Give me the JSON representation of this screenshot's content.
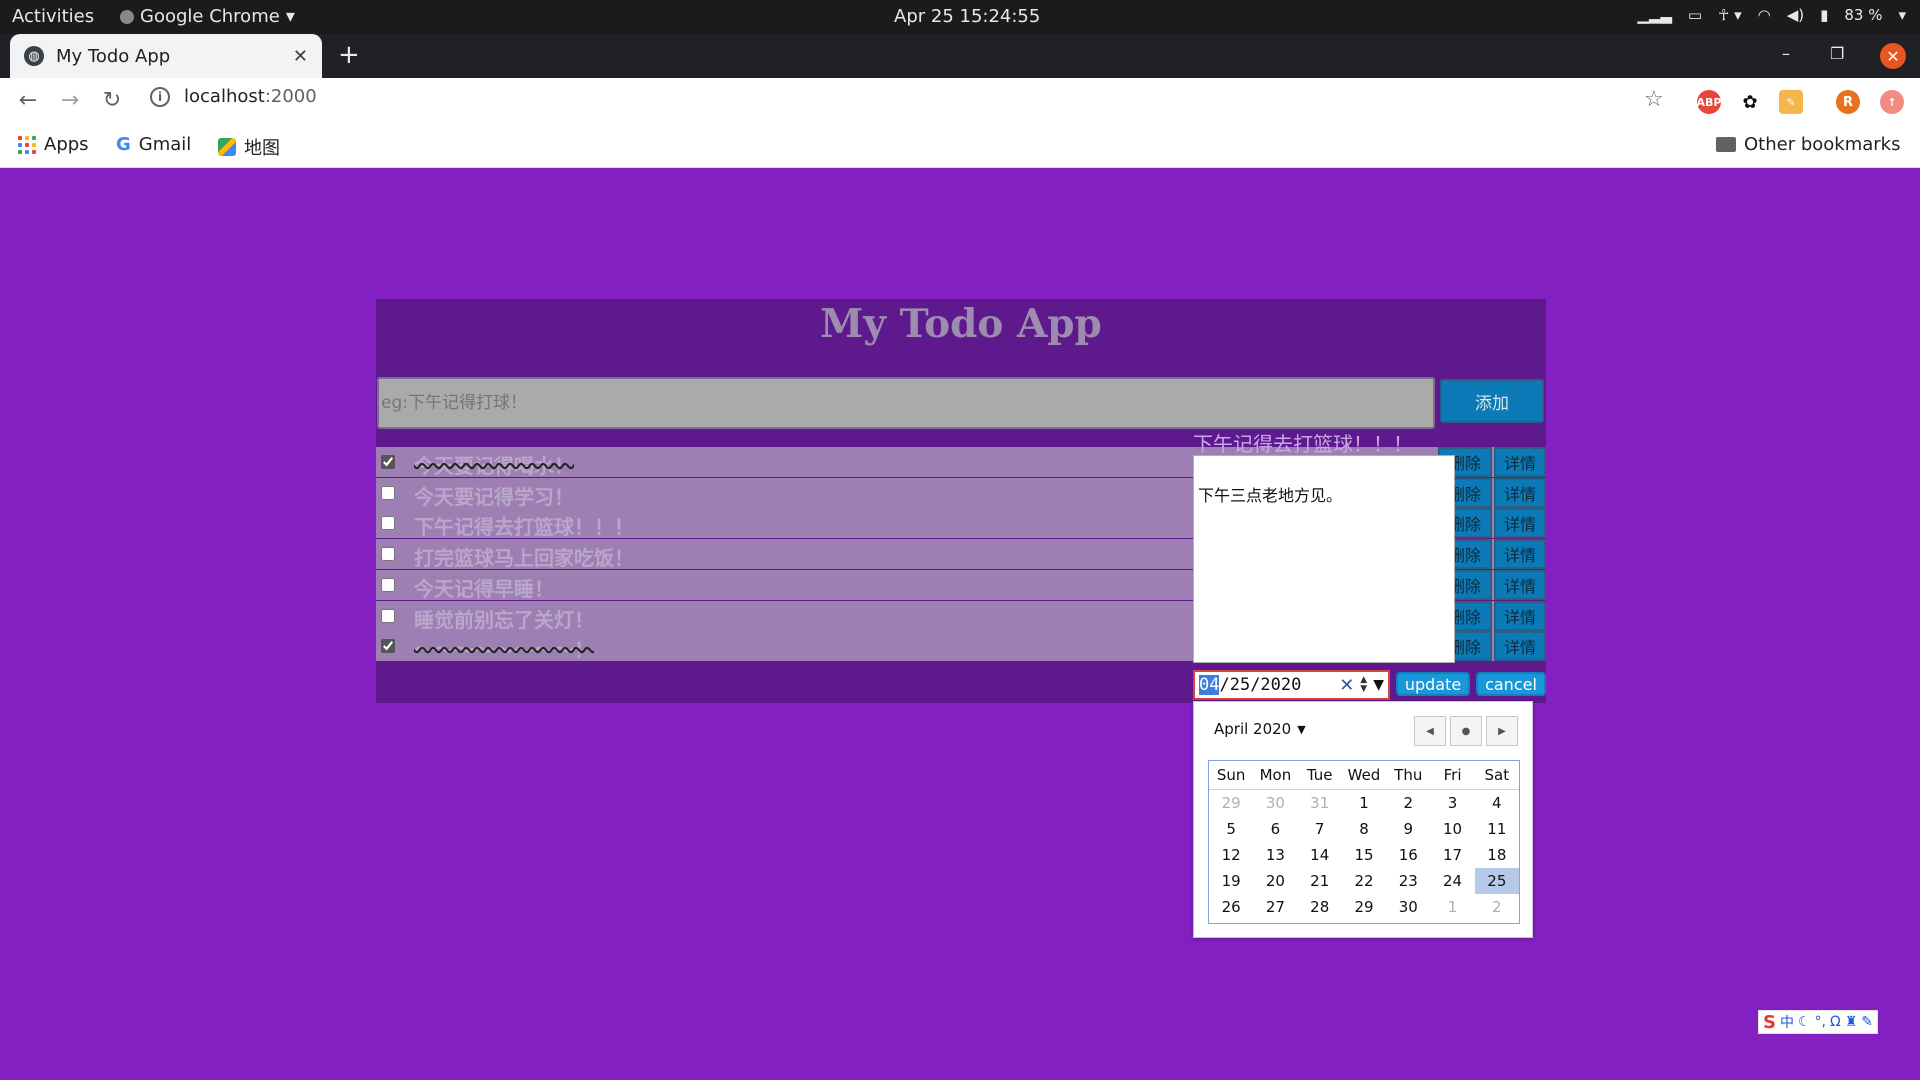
{
  "system": {
    "activities": "Activities",
    "app_name": "Google Chrome",
    "clock": "Apr 25  15:24:55",
    "battery": "83 %"
  },
  "browser": {
    "tab_title": "My Todo App",
    "url_host": "localhost",
    "url_port": ":2000",
    "bookmarks": {
      "apps": "Apps",
      "gmail": "Gmail",
      "maps": "地图",
      "other": "Other bookmarks"
    },
    "extensions": {
      "abp": "ABP",
      "profile": "R"
    }
  },
  "app": {
    "title": "My Todo App",
    "input_placeholder": "eg:下午记得打球！",
    "add_label": "添加",
    "delete_label": "删除",
    "detail_label": "详情",
    "todos": [
      {
        "text": "今天要记得喝水！",
        "done": true
      },
      {
        "text": "今天要记得学习！",
        "done": false
      },
      {
        "text": "下午记得去打篮球！！！",
        "done": false
      },
      {
        "text": "打完篮球马上回家吃饭！",
        "done": false
      },
      {
        "text": "今天记得早睡！",
        "done": false
      },
      {
        "text": "睡觉前别忘了关灯！",
        "done": false
      },
      {
        "text": "～～～～～～～～！",
        "done": true
      }
    ]
  },
  "detail": {
    "title": "下午记得去打篮球！！！",
    "body": "下午三点老地方见。",
    "date_month": "04",
    "date_rest": "/25/2020",
    "update_label": "update",
    "cancel_label": "cancel"
  },
  "calendar": {
    "month_label": "April 2020",
    "weekdays": [
      "Sun",
      "Mon",
      "Tue",
      "Wed",
      "Thu",
      "Fri",
      "Sat"
    ],
    "weeks": [
      [
        "29",
        "30",
        "31",
        "1",
        "2",
        "3",
        "4"
      ],
      [
        "5",
        "6",
        "7",
        "8",
        "9",
        "10",
        "11"
      ],
      [
        "12",
        "13",
        "14",
        "15",
        "16",
        "17",
        "18"
      ],
      [
        "19",
        "20",
        "21",
        "22",
        "23",
        "24",
        "25"
      ],
      [
        "26",
        "27",
        "28",
        "29",
        "30",
        "1",
        "2"
      ]
    ],
    "muted": [
      [
        0,
        0
      ],
      [
        0,
        1
      ],
      [
        0,
        2
      ],
      [
        4,
        5
      ],
      [
        4,
        6
      ]
    ],
    "selected": [
      3,
      6
    ]
  },
  "ime": {
    "label": "中"
  }
}
